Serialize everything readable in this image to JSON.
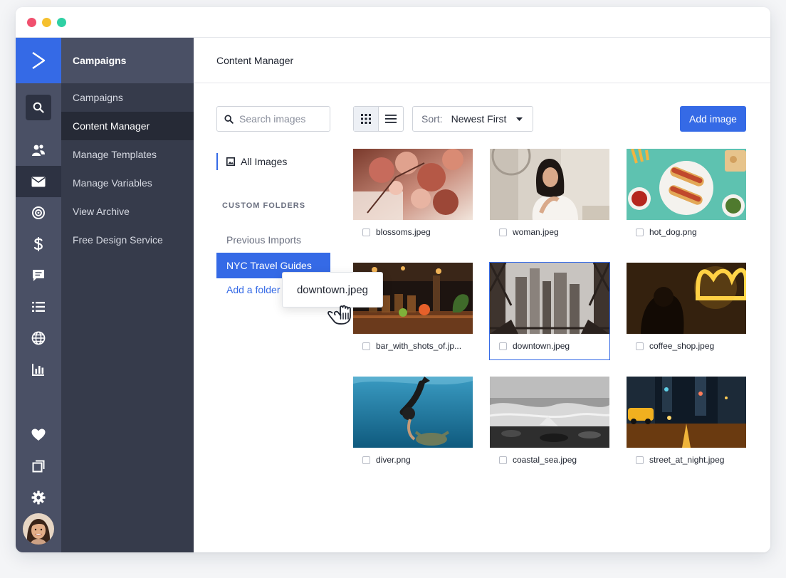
{
  "window": {
    "controls": [
      "close",
      "minimize",
      "maximize"
    ]
  },
  "rail": {
    "logo_icon": "chevron-right-icon",
    "icons": [
      "search-icon",
      "contacts-icon",
      "mail-icon",
      "target-icon",
      "dollar-icon",
      "chat-icon",
      "list-icon",
      "globe-icon",
      "reports-icon",
      "heart-icon",
      "pages-icon",
      "gear-icon"
    ],
    "active": "mail-icon"
  },
  "subnav": {
    "title": "Campaigns",
    "items": [
      {
        "label": "Campaigns"
      },
      {
        "label": "Content Manager",
        "active": true
      },
      {
        "label": "Manage Templates"
      },
      {
        "label": "Manage Variables"
      },
      {
        "label": "View Archive"
      },
      {
        "label": "Free Design Service"
      }
    ]
  },
  "header": {
    "title": "Content Manager"
  },
  "search": {
    "placeholder": "Search images",
    "value": ""
  },
  "library": {
    "all_images_label": "All Images",
    "custom_folders_heading": "CUSTOM FOLDERS",
    "folders": [
      {
        "label": "Previous Imports",
        "active": false
      },
      {
        "label": "NYC Travel Guides",
        "active": true
      }
    ],
    "add_folder_label": "Add a folder"
  },
  "drag": {
    "tooltip": "downtown.jpeg"
  },
  "toolbar": {
    "view_mode": "grid",
    "sort_label": "Sort:",
    "sort_value": "Newest First",
    "add_image_label": "Add image"
  },
  "images": [
    {
      "name": "blossoms.jpeg",
      "selected": false
    },
    {
      "name": "woman.jpeg",
      "selected": false
    },
    {
      "name": "hot_dog.png",
      "selected": false
    },
    {
      "name": "bar_with_shots_of.jp...",
      "selected": false
    },
    {
      "name": "downtown.jpeg",
      "selected": true
    },
    {
      "name": "coffee_shop.jpeg",
      "selected": false
    },
    {
      "name": "diver.png",
      "selected": false
    },
    {
      "name": "coastal_sea.jpeg",
      "selected": false
    },
    {
      "name": "street_at_night.jpeg",
      "selected": false
    }
  ],
  "colors": {
    "accent": "#356ae6",
    "rail": "#4a5065",
    "subnav": "#363b4b",
    "subnav_active": "#262a36"
  }
}
